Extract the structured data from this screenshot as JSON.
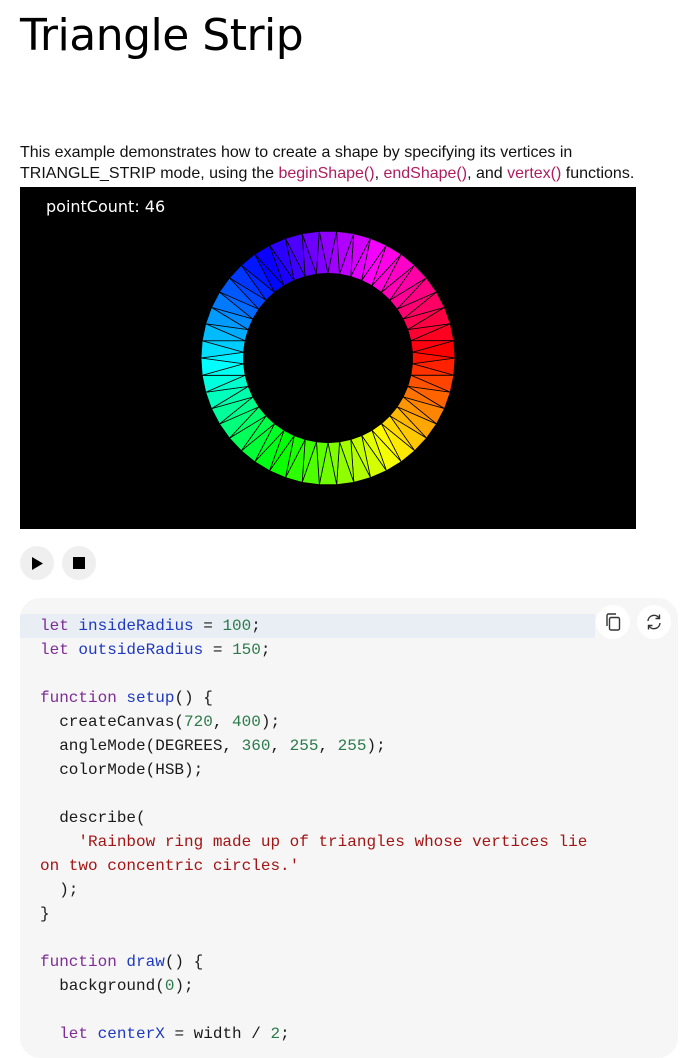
{
  "page": {
    "title": "Triangle Strip",
    "description": {
      "part1": "This example demonstrates how to create a shape by specifying its vertices in TRIANGLE_STRIP mode, using the ",
      "link1": "beginShape()",
      "sep1": ", ",
      "link2": "endShape()",
      "sep2": ", and ",
      "link3": "vertex()",
      "part2": " functions."
    }
  },
  "sketch": {
    "point_count_label": "pointCount: 46",
    "point_count": 46,
    "inside_radius": 100,
    "outside_radius": 150
  },
  "controls": {
    "play_icon": "play-icon",
    "stop_icon": "stop-icon",
    "copy_icon": "copy-icon",
    "reset_icon": "reset-icon"
  },
  "code": {
    "l1_kw": "let",
    "l1_id": "insideRadius",
    "l1_op": " = ",
    "l1_num": "100",
    "l1_end": ";",
    "l2_kw": "let",
    "l2_id": "outsideRadius",
    "l2_op": " = ",
    "l2_num": "150",
    "l2_end": ";",
    "l4_kw": "function",
    "l4_id": "setup",
    "l4_rest": "() {",
    "l5_a": "  createCanvas(",
    "l5_n1": "720",
    "l5_b": ", ",
    "l5_n2": "400",
    "l5_c": ");",
    "l6_a": "  angleMode(DEGREES, ",
    "l6_n1": "360",
    "l6_b": ", ",
    "l6_n2": "255",
    "l6_c": ", ",
    "l6_n3": "255",
    "l6_d": ");",
    "l7": "  colorMode(HSB);",
    "l9": "  describe(",
    "l10_indent": "    ",
    "l10_str": "'Rainbow ring made up of triangles whose vertices lie",
    "l11_str": "on two concentric circles.'",
    "l12": "  );",
    "l13": "}",
    "l15_kw": "function",
    "l15_id": "draw",
    "l15_rest": "() {",
    "l16_a": "  background(",
    "l16_n": "0",
    "l16_b": ");",
    "l18_indent": "  ",
    "l18_kw": "let",
    "l18_id": "centerX",
    "l18_op": " = width / ",
    "l18_num": "2",
    "l18_end": ";"
  },
  "colors": {
    "link": "#ad1d5f",
    "keyword": "#7d2d94",
    "identifier": "#1e38c0",
    "number": "#2b7a4b",
    "string": "#a31515"
  }
}
